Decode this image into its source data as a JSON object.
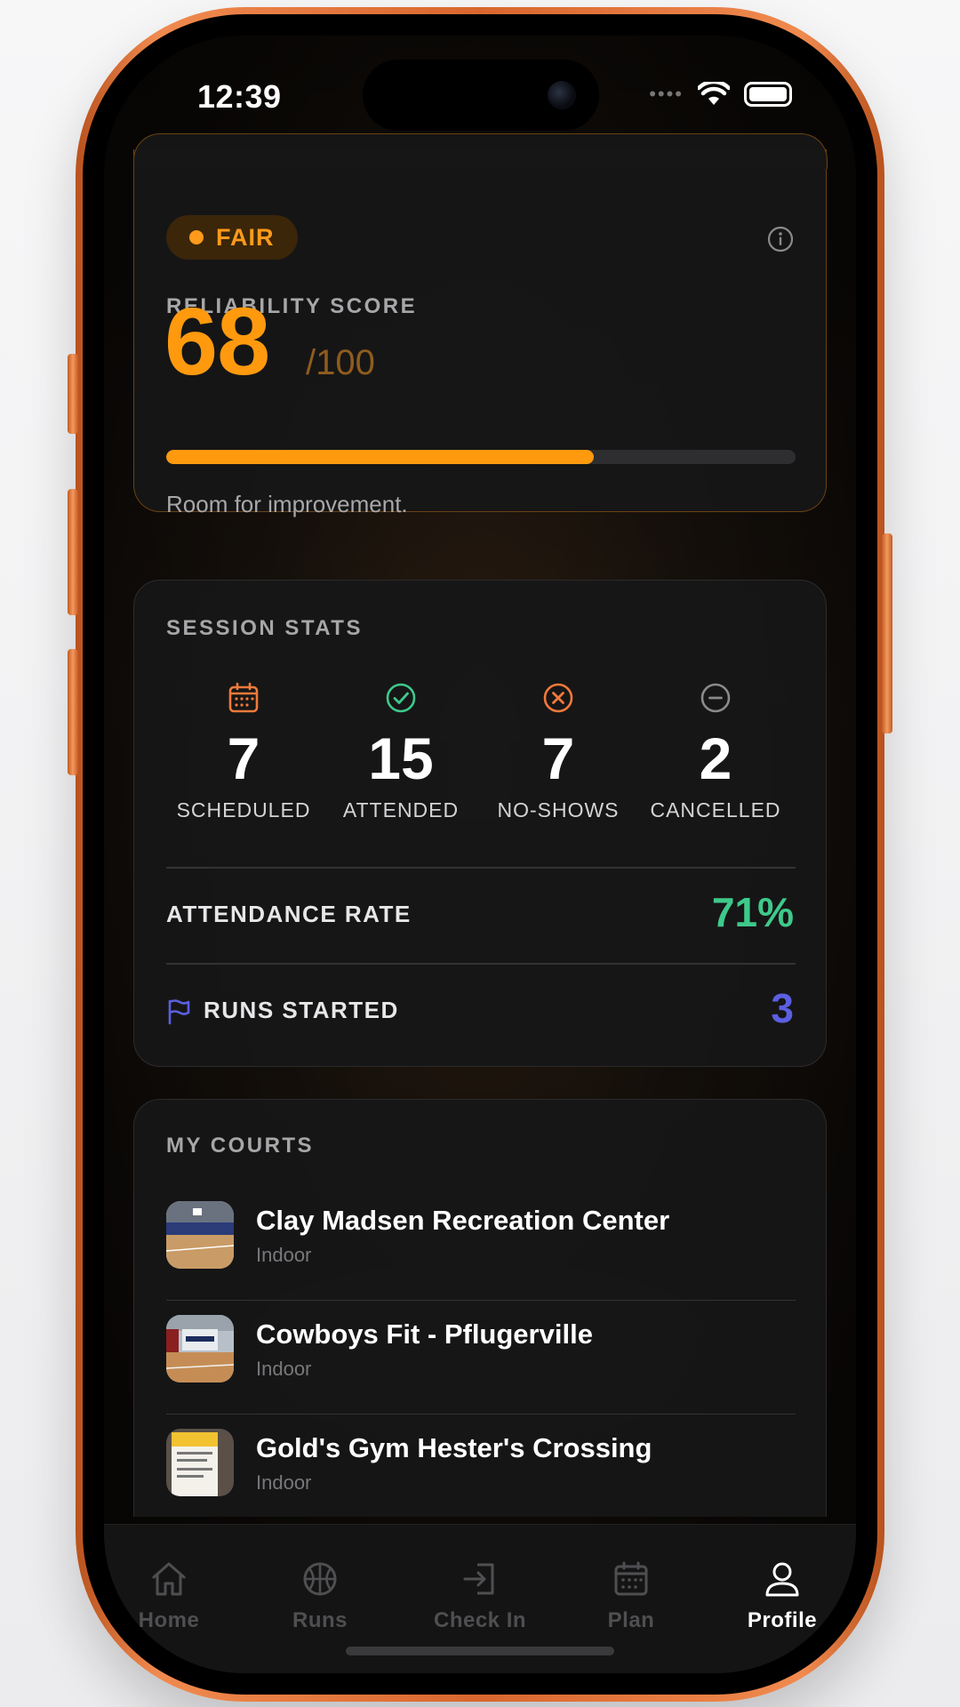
{
  "status_bar": {
    "time": "12:39"
  },
  "reliability": {
    "badge": "FAIR",
    "label": "RELIABILITY SCORE",
    "score": "68",
    "max": "/100",
    "progress_fraction": 0.68,
    "note": "Room for improvement.",
    "accent_color": "#ff9a0e"
  },
  "session_stats": {
    "title": "SESSION STATS",
    "stats": [
      {
        "icon": "calendar-icon",
        "value": "7",
        "label": "SCHEDULED",
        "color": "#f07a3a"
      },
      {
        "icon": "check-circle-icon",
        "value": "15",
        "label": "ATTENDED",
        "color": "#3ec98a"
      },
      {
        "icon": "x-circle-icon",
        "value": "7",
        "label": "NO-SHOWS",
        "color": "#f07a3a"
      },
      {
        "icon": "minus-circle-icon",
        "value": "2",
        "label": "CANCELLED",
        "color": "#8a8a8d"
      }
    ],
    "attendance_label": "ATTENDANCE RATE",
    "attendance_value": "71%",
    "attendance_color": "#3ec98a",
    "runs_label": "RUNS STARTED",
    "runs_value": "3",
    "runs_color": "#5b5fe0"
  },
  "courts": {
    "title": "MY COURTS",
    "items": [
      {
        "name": "Clay Madsen Recreation Center",
        "type": "Indoor"
      },
      {
        "name": "Cowboys Fit - Pflugerville",
        "type": "Indoor"
      },
      {
        "name": "Gold's Gym Hester's Crossing",
        "type": "Indoor"
      }
    ]
  },
  "tabbar": {
    "items": [
      {
        "label": "Home",
        "icon": "home-icon"
      },
      {
        "label": "Runs",
        "icon": "basketball-icon"
      },
      {
        "label": "Check In",
        "icon": "check-in-icon"
      },
      {
        "label": "Plan",
        "icon": "calendar-icon"
      },
      {
        "label": "Profile",
        "icon": "profile-icon"
      }
    ],
    "active": "Profile"
  }
}
